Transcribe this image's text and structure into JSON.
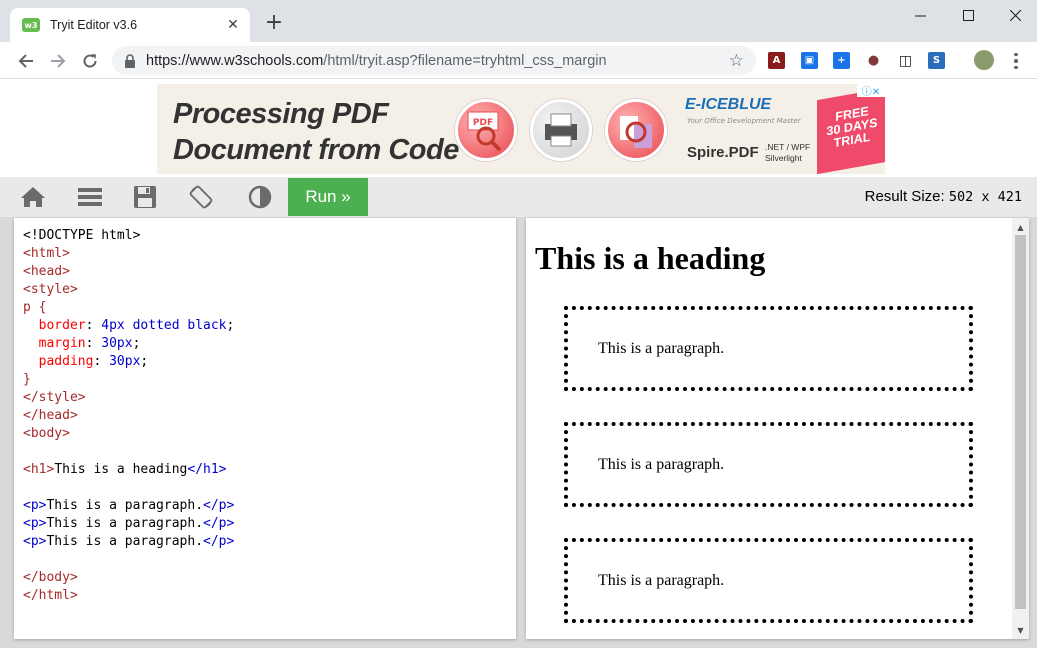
{
  "browser": {
    "tab_title": "Tryit Editor v3.6",
    "favicon_text": "w3",
    "url_domain": "https://www.w3schools.com",
    "url_path": "/html/tryit.asp?filename=tryhtml_css_margin"
  },
  "ad": {
    "headline_line1": "Processing PDF",
    "headline_line2": "Document from Code",
    "pdf_label": "PDF",
    "brand": "E-ICEBLUE",
    "brand_tagline": "Your Office Development Master",
    "product": "Spire.PDF",
    "platforms_line1": ".NET / WPF",
    "platforms_line2": "Silverlight",
    "ribbon_line1": "FREE",
    "ribbon_line2": "30 DAYS",
    "ribbon_line3": "TRIAL"
  },
  "w3toolbar": {
    "run_label": "Run »",
    "result_size_label": "Result Size:",
    "result_size_value": "502 x 421"
  },
  "code": {
    "doctype": "<!DOCTYPE html>",
    "html_open": "<html>",
    "head_open": "<head>",
    "style_open": "<style>",
    "selector": "p {",
    "prop1": "border",
    "val1": "4px dotted black",
    "prop2": "margin",
    "val2": "30px",
    "prop3": "padding",
    "val3": "30px",
    "brace_close": "}",
    "style_close": "</style>",
    "head_close": "</head>",
    "body_open": "<body>",
    "h1_open": "<h1>",
    "h1_text": "This is a heading",
    "h1_close": "</h1>",
    "p_open": "<p>",
    "p_text": "This is a paragraph.",
    "p_close": "</p>",
    "body_close": "</body>",
    "html_close": "</html>"
  },
  "result": {
    "heading": "This is a heading",
    "paragraphs": [
      "This is a paragraph.",
      "This is a paragraph.",
      "This is a paragraph."
    ]
  }
}
